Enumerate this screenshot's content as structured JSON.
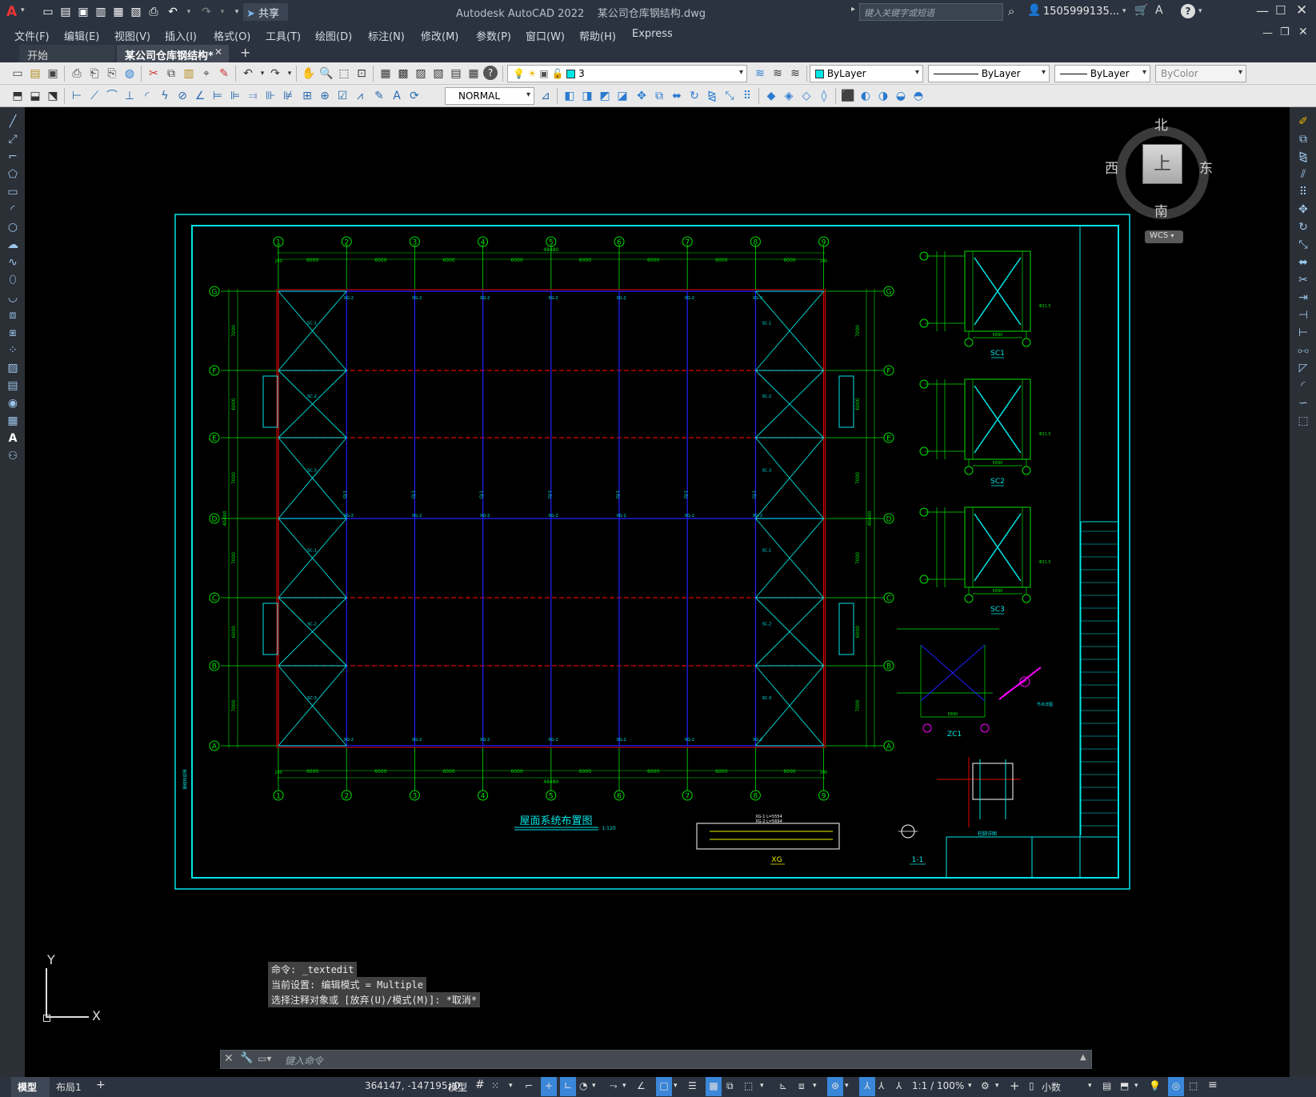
{
  "app": {
    "title": "Autodesk AutoCAD 2022",
    "file_name": "某公司仓库钢结构.dwg",
    "share_label": "共享",
    "search_placeholder": "键入关键字或短语",
    "user": "1505999135...",
    "logo": "A"
  },
  "menu": [
    "文件(F)",
    "编辑(E)",
    "视图(V)",
    "插入(I)",
    "格式(O)",
    "工具(T)",
    "绘图(D)",
    "标注(N)",
    "修改(M)",
    "参数(P)",
    "窗口(W)",
    "帮助(H)",
    "Express"
  ],
  "tabs": [
    {
      "label": "开始"
    },
    {
      "label": "某公司仓库钢结构*"
    }
  ],
  "toolbar": {
    "layer_value": "3",
    "color_value": "ByLayer",
    "linetype_value": "ByLayer",
    "lineweight_value": "ByLayer",
    "plotstyle_value": "ByColor",
    "textstyle_value": "NORMAL"
  },
  "viewcube": {
    "north": "北",
    "south": "南",
    "east": "东",
    "west": "西",
    "top": "上",
    "wcs": "WCS"
  },
  "ucs": {
    "x": "X",
    "y": "Y"
  },
  "command_history": [
    "命令: _textedit",
    "当前设置: 编辑模式 = Multiple",
    "选择注释对象或 [放弃(U)/模式(M)]: *取消*"
  ],
  "command_placeholder": "键入命令",
  "status": {
    "model_tab": "模型",
    "layout_tab": "布局1",
    "coords": "364147, -147195, 0",
    "model_label": "模型",
    "scale": "1:1 / 100%",
    "units": "小数"
  },
  "drawing": {
    "grid_cols": [
      "1",
      "2",
      "3",
      "4",
      "5",
      "6",
      "7",
      "8",
      "9"
    ],
    "grid_rows": [
      "G",
      "F",
      "E",
      "D",
      "C",
      "B",
      "A"
    ],
    "bay_dim": "6000",
    "end_dim": "240",
    "total_x": "48480",
    "total_y": "40480",
    "row_dims": [
      "7000",
      "6000",
      "7000",
      "7000",
      "6000",
      "7000"
    ],
    "title": "屋面系统布置图",
    "scale": "1:120",
    "details": [
      "SC1",
      "SC2",
      "SC3",
      "ZC1",
      "XG",
      "1-1"
    ],
    "detail_dims": {
      "sc_width": "5890",
      "zc_width": "5890",
      "xg_len": "XG-1 L=5554",
      "xg_len2": "XG-2 L=5694"
    }
  },
  "colors": {
    "ui_dark": "#2b3340",
    "toolbar_bg": "#e9e9e9",
    "cyan": "#00e5e5",
    "green": "#00e000",
    "blue": "#2020ff",
    "red": "#e00000",
    "magenta": "#ff00ff",
    "yellow": "#f0f000"
  }
}
